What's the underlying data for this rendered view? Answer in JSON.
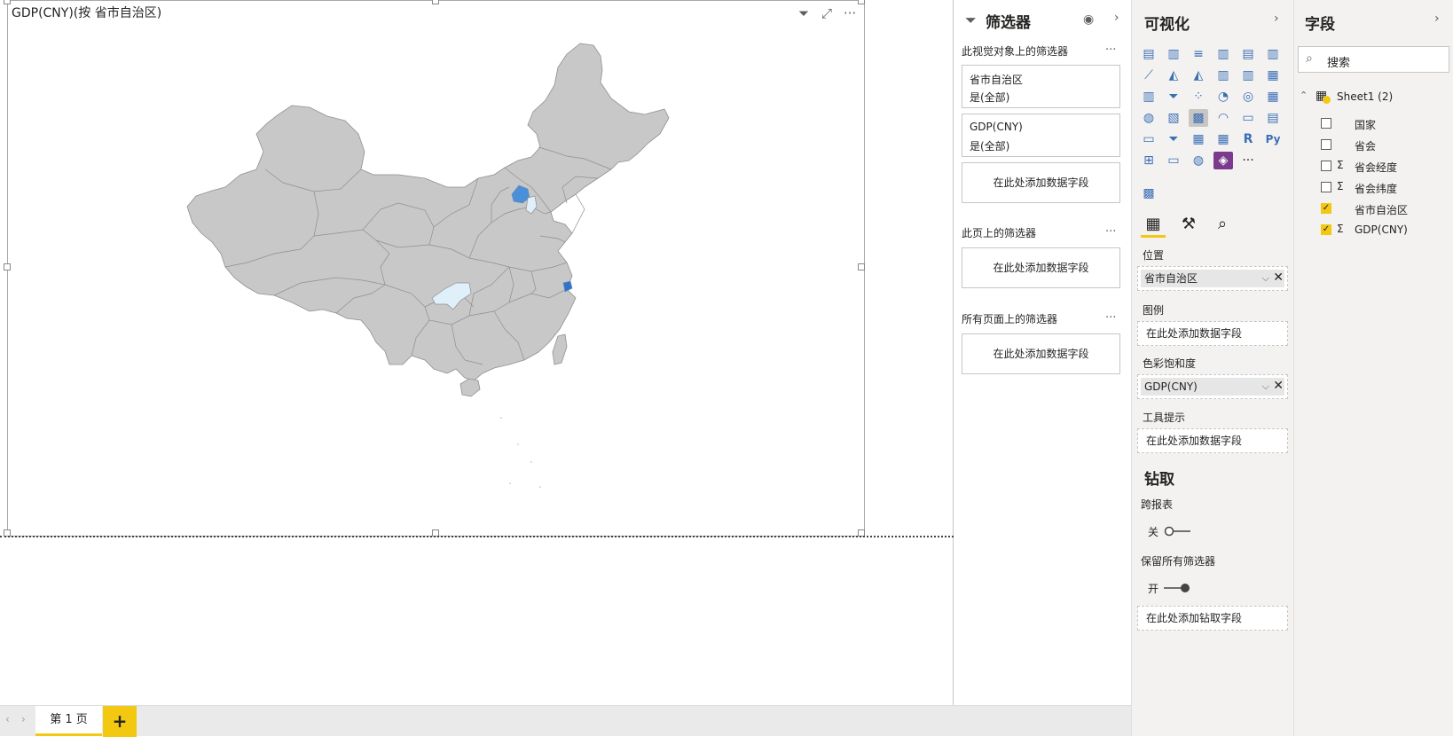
{
  "visual": {
    "title": "GDP(CNY)(按 省市自治区)",
    "header_icons": [
      "filter-icon",
      "focus-mode-icon",
      "more-options-icon"
    ],
    "map": {
      "highlighted_regions": [
        {
          "region": "北京",
          "color": "#4a8fd9"
        },
        {
          "region": "天津",
          "color": "#dff0fa"
        },
        {
          "region": "重庆",
          "color": "#dff0fa"
        },
        {
          "region": "上海",
          "color": "#2f74c8"
        }
      ],
      "base_color": "#c8c8c8"
    }
  },
  "tabs": {
    "page1": "第 1 页",
    "add": "+"
  },
  "filters": {
    "title": "筛选器",
    "visual_section": "此视觉对象上的筛选器",
    "cards": [
      {
        "name": "省市自治区",
        "value": "是(全部)"
      },
      {
        "name": "GDP(CNY)",
        "value": "是(全部)"
      }
    ],
    "add_field": "在此处添加数据字段",
    "page_section": "此页上的筛选器",
    "all_pages_section": "所有页面上的筛选器",
    "more": "···"
  },
  "viz": {
    "title": "可视化",
    "more": "···",
    "wells": {
      "location_label": "位置",
      "location_value": "省市自治区",
      "legend_label": "图例",
      "legend_placeholder": "在此处添加数据字段",
      "saturation_label": "色彩饱和度",
      "saturation_value": "GDP(CNY)",
      "tooltip_label": "工具提示",
      "tooltip_placeholder": "在此处添加数据字段"
    },
    "drill": {
      "title": "钻取",
      "cross_report_label": "跨报表",
      "cross_report_state": "关",
      "keep_filters_label": "保留所有筛选器",
      "keep_filters_state": "开",
      "drill_placeholder": "在此处添加钻取字段"
    }
  },
  "fields": {
    "title": "字段",
    "search_placeholder": "搜索",
    "table_name": "Sheet1 (2)",
    "items": [
      {
        "name": "国家",
        "checked": false,
        "sigma": false
      },
      {
        "name": "省会",
        "checked": false,
        "sigma": false
      },
      {
        "name": "省会经度",
        "checked": false,
        "sigma": true
      },
      {
        "name": "省会纬度",
        "checked": false,
        "sigma": true
      },
      {
        "name": "省市自治区",
        "checked": true,
        "sigma": false
      },
      {
        "name": "GDP(CNY)",
        "checked": true,
        "sigma": true
      }
    ]
  },
  "colors": {
    "accent": "#f2c811",
    "pane_bg": "#f3f2f1"
  }
}
